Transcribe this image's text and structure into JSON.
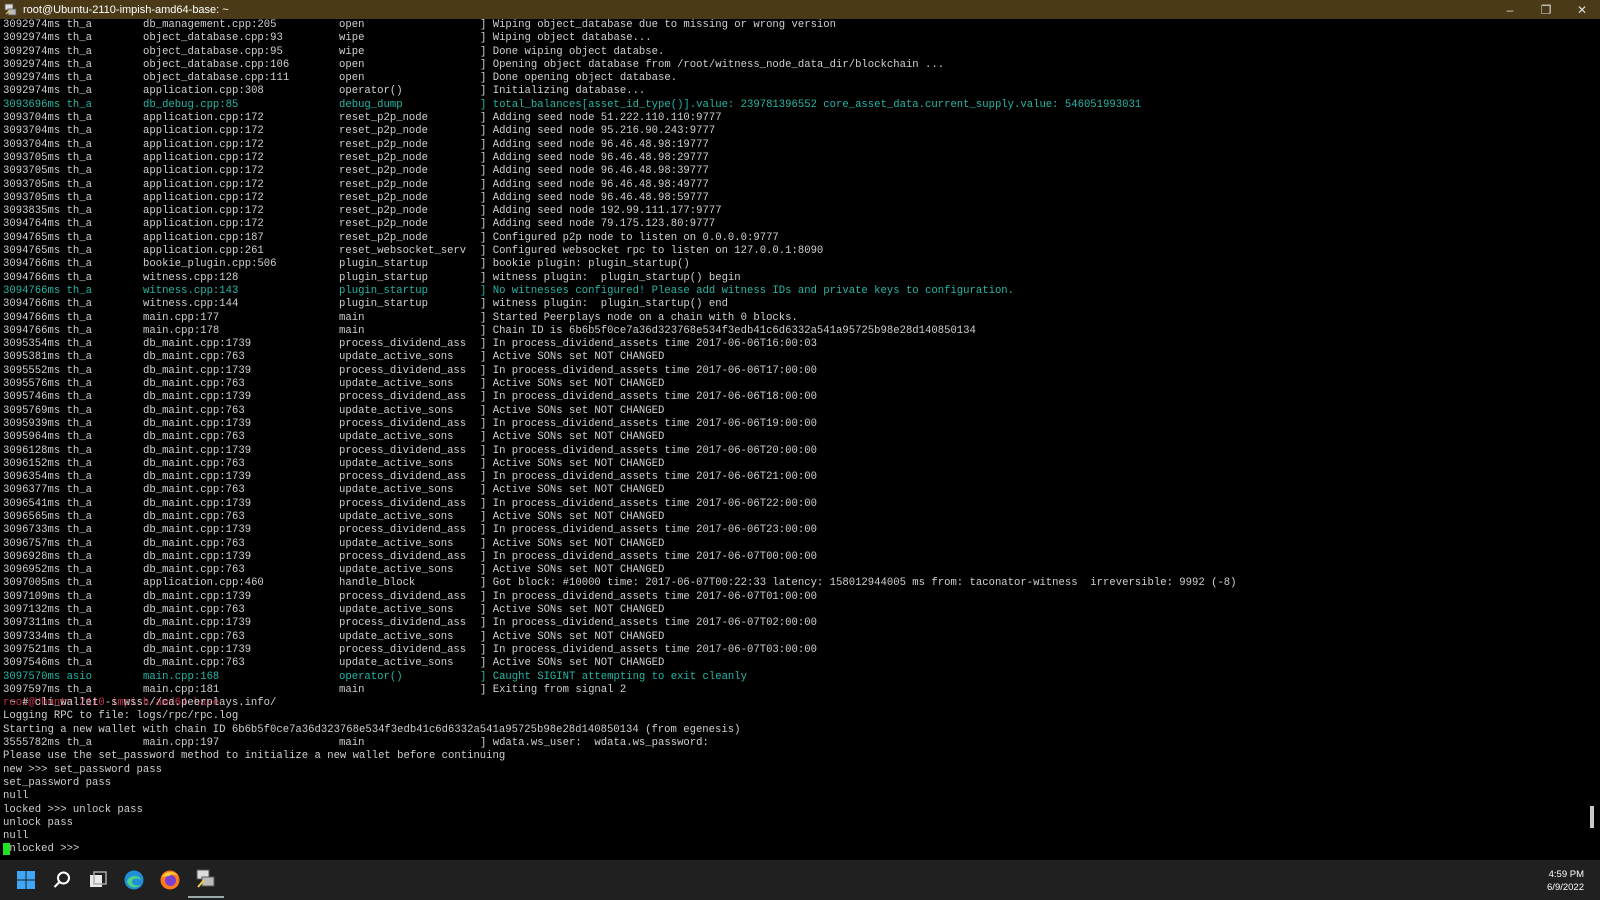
{
  "window": {
    "title": "root@Ubuntu-2110-impish-amd64-base: ~",
    "minimize_label": "–",
    "maximize_label": "❐",
    "close_label": "✕"
  },
  "log": [
    {
      "t": "3092974ms th_a",
      "f": "db_management.cpp:205",
      "fn": "open",
      "m": "] Wiping object_database due to missing or wrong version"
    },
    {
      "t": "3092974ms th_a",
      "f": "object_database.cpp:93",
      "fn": "wipe",
      "m": "] Wiping object database..."
    },
    {
      "t": "3092974ms th_a",
      "f": "object_database.cpp:95",
      "fn": "wipe",
      "m": "] Done wiping object databse."
    },
    {
      "t": "3092974ms th_a",
      "f": "object_database.cpp:106",
      "fn": "open",
      "m": "] Opening object database from /root/witness_node_data_dir/blockchain ..."
    },
    {
      "t": "3092974ms th_a",
      "f": "object_database.cpp:111",
      "fn": "open",
      "m": "] Done opening object database."
    },
    {
      "t": "3092974ms th_a",
      "f": "application.cpp:308",
      "fn": "operator()",
      "m": "] Initializing database..."
    },
    {
      "t": "3093696ms th_a",
      "f": "db_debug.cpp:85",
      "fn": "debug_dump",
      "m": "] total_balances[asset_id_type()].value: 239781396552 core_asset_data.current_supply.value: 546051993031",
      "cyan": true
    },
    {
      "t": "3093704ms th_a",
      "f": "application.cpp:172",
      "fn": "reset_p2p_node",
      "m": "] Adding seed node 51.222.110.110:9777"
    },
    {
      "t": "3093704ms th_a",
      "f": "application.cpp:172",
      "fn": "reset_p2p_node",
      "m": "] Adding seed node 95.216.90.243:9777"
    },
    {
      "t": "3093704ms th_a",
      "f": "application.cpp:172",
      "fn": "reset_p2p_node",
      "m": "] Adding seed node 96.46.48.98:19777"
    },
    {
      "t": "3093705ms th_a",
      "f": "application.cpp:172",
      "fn": "reset_p2p_node",
      "m": "] Adding seed node 96.46.48.98:29777"
    },
    {
      "t": "3093705ms th_a",
      "f": "application.cpp:172",
      "fn": "reset_p2p_node",
      "m": "] Adding seed node 96.46.48.98:39777"
    },
    {
      "t": "3093705ms th_a",
      "f": "application.cpp:172",
      "fn": "reset_p2p_node",
      "m": "] Adding seed node 96.46.48.98:49777"
    },
    {
      "t": "3093705ms th_a",
      "f": "application.cpp:172",
      "fn": "reset_p2p_node",
      "m": "] Adding seed node 96.46.48.98:59777"
    },
    {
      "t": "3093835ms th_a",
      "f": "application.cpp:172",
      "fn": "reset_p2p_node",
      "m": "] Adding seed node 192.99.111.177:9777"
    },
    {
      "t": "3094764ms th_a",
      "f": "application.cpp:172",
      "fn": "reset_p2p_node",
      "m": "] Adding seed node 79.175.123.80:9777"
    },
    {
      "t": "3094765ms th_a",
      "f": "application.cpp:187",
      "fn": "reset_p2p_node",
      "m": "] Configured p2p node to listen on 0.0.0.0:9777"
    },
    {
      "t": "3094765ms th_a",
      "f": "application.cpp:261",
      "fn": "reset_websocket_serv",
      "m": "] Configured websocket rpc to listen on 127.0.0.1:8090"
    },
    {
      "t": "3094766ms th_a",
      "f": "bookie_plugin.cpp:506",
      "fn": "plugin_startup",
      "m": "] bookie plugin: plugin_startup()"
    },
    {
      "t": "3094766ms th_a",
      "f": "witness.cpp:128",
      "fn": "plugin_startup",
      "m": "] witness plugin:  plugin_startup() begin"
    },
    {
      "t": "3094766ms th_a",
      "f": "witness.cpp:143",
      "fn": "plugin_startup",
      "m": "] No witnesses configured! Please add witness IDs and private keys to configuration.",
      "cyan": true
    },
    {
      "t": "3094766ms th_a",
      "f": "witness.cpp:144",
      "fn": "plugin_startup",
      "m": "] witness plugin:  plugin_startup() end"
    },
    {
      "t": "3094766ms th_a",
      "f": "main.cpp:177",
      "fn": "main",
      "m": "] Started Peerplays node on a chain with 0 blocks."
    },
    {
      "t": "3094766ms th_a",
      "f": "main.cpp:178",
      "fn": "main",
      "m": "] Chain ID is 6b6b5f0ce7a36d323768e534f3edb41c6d6332a541a95725b98e28d140850134"
    },
    {
      "t": "3095354ms th_a",
      "f": "db_maint.cpp:1739",
      "fn": "process_dividend_ass",
      "m": "] In process_dividend_assets time 2017-06-06T16:00:03"
    },
    {
      "t": "3095381ms th_a",
      "f": "db_maint.cpp:763",
      "fn": "update_active_sons",
      "m": "] Active SONs set NOT CHANGED"
    },
    {
      "t": "3095552ms th_a",
      "f": "db_maint.cpp:1739",
      "fn": "process_dividend_ass",
      "m": "] In process_dividend_assets time 2017-06-06T17:00:00"
    },
    {
      "t": "3095576ms th_a",
      "f": "db_maint.cpp:763",
      "fn": "update_active_sons",
      "m": "] Active SONs set NOT CHANGED"
    },
    {
      "t": "3095746ms th_a",
      "f": "db_maint.cpp:1739",
      "fn": "process_dividend_ass",
      "m": "] In process_dividend_assets time 2017-06-06T18:00:00"
    },
    {
      "t": "3095769ms th_a",
      "f": "db_maint.cpp:763",
      "fn": "update_active_sons",
      "m": "] Active SONs set NOT CHANGED"
    },
    {
      "t": "3095939ms th_a",
      "f": "db_maint.cpp:1739",
      "fn": "process_dividend_ass",
      "m": "] In process_dividend_assets time 2017-06-06T19:00:00"
    },
    {
      "t": "3095964ms th_a",
      "f": "db_maint.cpp:763",
      "fn": "update_active_sons",
      "m": "] Active SONs set NOT CHANGED"
    },
    {
      "t": "3096128ms th_a",
      "f": "db_maint.cpp:1739",
      "fn": "process_dividend_ass",
      "m": "] In process_dividend_assets time 2017-06-06T20:00:00"
    },
    {
      "t": "3096152ms th_a",
      "f": "db_maint.cpp:763",
      "fn": "update_active_sons",
      "m": "] Active SONs set NOT CHANGED"
    },
    {
      "t": "3096354ms th_a",
      "f": "db_maint.cpp:1739",
      "fn": "process_dividend_ass",
      "m": "] In process_dividend_assets time 2017-06-06T21:00:00"
    },
    {
      "t": "3096377ms th_a",
      "f": "db_maint.cpp:763",
      "fn": "update_active_sons",
      "m": "] Active SONs set NOT CHANGED"
    },
    {
      "t": "3096541ms th_a",
      "f": "db_maint.cpp:1739",
      "fn": "process_dividend_ass",
      "m": "] In process_dividend_assets time 2017-06-06T22:00:00"
    },
    {
      "t": "3096565ms th_a",
      "f": "db_maint.cpp:763",
      "fn": "update_active_sons",
      "m": "] Active SONs set NOT CHANGED"
    },
    {
      "t": "3096733ms th_a",
      "f": "db_maint.cpp:1739",
      "fn": "process_dividend_ass",
      "m": "] In process_dividend_assets time 2017-06-06T23:00:00"
    },
    {
      "t": "3096757ms th_a",
      "f": "db_maint.cpp:763",
      "fn": "update_active_sons",
      "m": "] Active SONs set NOT CHANGED"
    },
    {
      "t": "3096928ms th_a",
      "f": "db_maint.cpp:1739",
      "fn": "process_dividend_ass",
      "m": "] In process_dividend_assets time 2017-06-07T00:00:00"
    },
    {
      "t": "3096952ms th_a",
      "f": "db_maint.cpp:763",
      "fn": "update_active_sons",
      "m": "] Active SONs set NOT CHANGED"
    },
    {
      "t": "3097005ms th_a",
      "f": "application.cpp:460",
      "fn": "handle_block",
      "m": "] Got block: #10000 time: 2017-06-07T00:22:33 latency: 158012944005 ms from: taconator-witness  irreversible: 9992 (-8)"
    },
    {
      "t": "3097109ms th_a",
      "f": "db_maint.cpp:1739",
      "fn": "process_dividend_ass",
      "m": "] In process_dividend_assets time 2017-06-07T01:00:00"
    },
    {
      "t": "3097132ms th_a",
      "f": "db_maint.cpp:763",
      "fn": "update_active_sons",
      "m": "] Active SONs set NOT CHANGED"
    },
    {
      "t": "3097311ms th_a",
      "f": "db_maint.cpp:1739",
      "fn": "process_dividend_ass",
      "m": "] In process_dividend_assets time 2017-06-07T02:00:00"
    },
    {
      "t": "3097334ms th_a",
      "f": "db_maint.cpp:763",
      "fn": "update_active_sons",
      "m": "] Active SONs set NOT CHANGED"
    },
    {
      "t": "3097521ms th_a",
      "f": "db_maint.cpp:1739",
      "fn": "process_dividend_ass",
      "m": "] In process_dividend_assets time 2017-06-07T03:00:00"
    },
    {
      "t": "3097546ms th_a",
      "f": "db_maint.cpp:763",
      "fn": "update_active_sons",
      "m": "] Active SONs set NOT CHANGED"
    },
    {
      "t": "3097570ms asio",
      "f": "main.cpp:168",
      "fn": "operator()",
      "m": "] Caught SIGINT attempting to exit cleanly",
      "cyan": true
    },
    {
      "t": "3097597ms th_a",
      "f": "main.cpp:181",
      "fn": "main",
      "m": "] Exiting from signal 2"
    }
  ],
  "prompt": {
    "user_host": "root@Ubuntu-2110-impish-amd64-base",
    "rest": " ~ # cli_wallet -s wss://ca.peerplays.info/"
  },
  "post_lines": [
    "Logging RPC to file: logs/rpc/rpc.log",
    "Starting a new wallet with chain ID 6b6b5f0ce7a36d323768e534f3edb41c6d6332a541a95725b98e28d140850134 (from egenesis)"
  ],
  "mid_log": {
    "t": "3555782ms th_a",
    "f": "main.cpp:197",
    "fn": "main",
    "m": "] wdata.ws_user:  wdata.ws_password:"
  },
  "tail_lines": [
    "Please use the set_password method to initialize a new wallet before continuing",
    "new >>> set_password pass",
    "set_password pass",
    "null",
    "locked >>> unlock pass",
    "unlock pass",
    "null"
  ],
  "input_prompt": "unlocked >>> ",
  "taskbar": {
    "icons": [
      "windows-start-icon",
      "search-icon",
      "task-view-icon",
      "edge-icon",
      "firefox-icon",
      "putty-icon"
    ],
    "time": "4:59 PM",
    "date": "6/9/2022"
  }
}
